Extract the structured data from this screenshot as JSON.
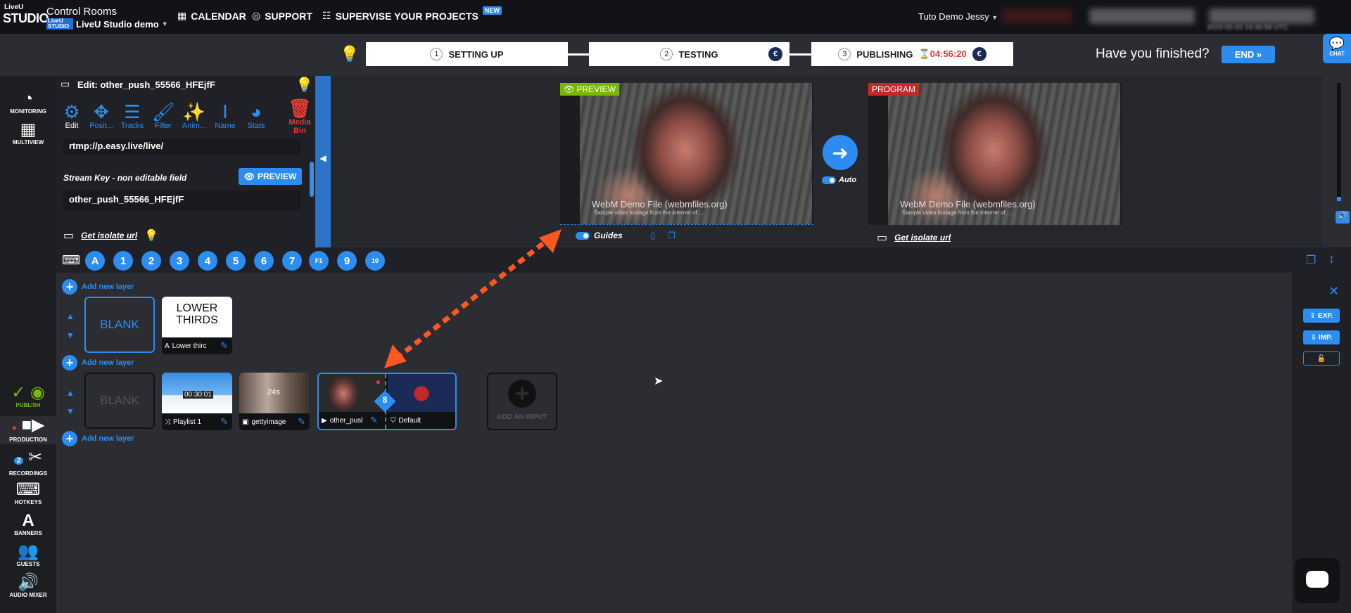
{
  "topbar": {
    "logo_top": "LiveU",
    "logo_main": "STUDIO",
    "title": "Control Rooms",
    "room_name": "LiveU Studio demo",
    "nav": [
      {
        "label": "CALENDAR",
        "icon": "calendar-icon"
      },
      {
        "label": "SUPPORT",
        "icon": "lifebuoy-icon"
      },
      {
        "label": "SUPERVISE YOUR PROJECTS",
        "icon": "grid-icon",
        "badge": "NEW"
      }
    ],
    "user": "Tuto Demo Jessy",
    "time_utc": "2023-05-03 19:46:58 UTC"
  },
  "chat_label": "CHAT",
  "steps": [
    {
      "num": "1",
      "label": "SETTING UP"
    },
    {
      "num": "2",
      "label": "TESTING"
    },
    {
      "num": "3",
      "label": "PUBLISHING",
      "timer": "04:56:20"
    }
  ],
  "finish_prompt": "Have you finished?",
  "end_label": "END",
  "rail": [
    {
      "label": "MONITORING",
      "icon": "gauge-icon"
    },
    {
      "label": "MULTIVIEW",
      "icon": "multiview-icon"
    },
    {
      "label": "PUBLISH",
      "icon": "broadcast-icon"
    },
    {
      "label": "PRODUCTION",
      "icon": "camera-icon"
    },
    {
      "label": "RECORDINGS",
      "icon": "scissors-icon",
      "badge": "2"
    },
    {
      "label": "HOTKEYS",
      "icon": "keyboard-icon"
    },
    {
      "label": "BANNERS",
      "icon": "banner-icon"
    },
    {
      "label": "GUESTS",
      "icon": "guests-icon"
    },
    {
      "label": "AUDIO MIXER",
      "icon": "speaker-icon"
    }
  ],
  "edit": {
    "title": "Edit: other_push_55566_HFEjfF",
    "tools": [
      "Edit",
      "Posit...",
      "Tracks",
      "Filter",
      "Anim...",
      "Name",
      "Stats"
    ],
    "media_bin": "Media Bin",
    "url_value": "rtmp://p.easy.live/live/",
    "stream_key_label": "Stream Key - non editable field",
    "preview_btn": "PREVIEW",
    "stream_key": "other_push_55566_HFEjfF",
    "isolate_link": "Get isolate url"
  },
  "video": {
    "preview_tag": "PREVIEW",
    "program_tag": "PROGRAM",
    "watermark": "WebM Demo File (webmfiles.org)",
    "watermark_sub": "Sample video footage from the internet of ...",
    "guides": "Guides",
    "auto": "Auto",
    "isolate_link": "Get isolate url"
  },
  "hotkeys": [
    "A",
    "1",
    "2",
    "3",
    "4",
    "5",
    "6",
    "7",
    "F1",
    "9",
    "10"
  ],
  "layers": {
    "add_layer": "Add new layer",
    "blank": "BLANK",
    "lower_thirds_thumb": "LOWER THIRDS",
    "lower_thirds_cap": "Lower thirc",
    "playlist_cap": "Playlist 1",
    "getty_cap": "gettyimage",
    "push_cap": "other_pusl",
    "default_cap": "Default",
    "add_input": "ADD AN INPUT",
    "playlist_time": "00:30:01",
    "getty_time": "24s",
    "slot_num": "8"
  },
  "right": {
    "exp": "EXP.",
    "imp": "IMP."
  },
  "colors": {
    "accent": "#2d8cf0",
    "preview_tag": "#7ab800",
    "program_tag": "#c62828",
    "annotation_arrow": "#ff5722"
  }
}
